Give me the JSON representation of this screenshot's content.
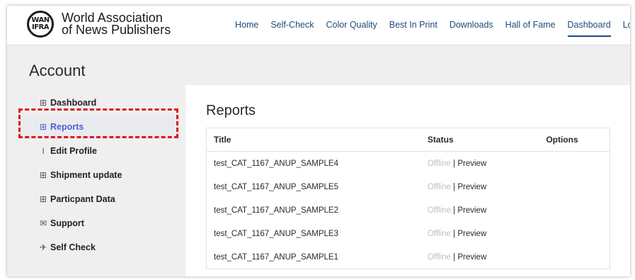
{
  "header": {
    "logo_mark_top": "WAN",
    "logo_mark_bottom": "IFRA",
    "org_line1": "World Association",
    "org_line2": "of News Publishers",
    "nav": [
      "Home",
      "Self-Check",
      "Color Quality",
      "Best In Print",
      "Downloads",
      "Hall of Fame",
      "Dashboard",
      "Logout"
    ],
    "active_nav": "Dashboard"
  },
  "account_title": "Account",
  "sidebar": {
    "items": [
      {
        "label": "Dashboard",
        "icon": "grid-icon",
        "glyph": "⊞"
      },
      {
        "label": "Reports",
        "icon": "grid-icon",
        "glyph": "⊞"
      },
      {
        "label": "Edit Profile",
        "icon": "text-cursor-icon",
        "glyph": "I"
      },
      {
        "label": "Shipment update",
        "icon": "grid-icon",
        "glyph": "⊞"
      },
      {
        "label": "Particpant Data",
        "icon": "grid-icon",
        "glyph": "⊞"
      },
      {
        "label": "Support",
        "icon": "envelope-icon",
        "glyph": "✉"
      },
      {
        "label": "Self Check",
        "icon": "send-icon",
        "glyph": "✈"
      }
    ],
    "active": "Reports"
  },
  "reports": {
    "title": "Reports",
    "columns": [
      "Title",
      "Status",
      "Options"
    ],
    "rows": [
      {
        "title": "test_CAT_1167_ANUP_SAMPLE4",
        "status": "Offline",
        "action": "Preview"
      },
      {
        "title": "test_CAT_1167_ANUP_SAMPLE5",
        "status": "Offline",
        "action": "Preview"
      },
      {
        "title": "test_CAT_1167_ANUP_SAMPLE2",
        "status": "Offline",
        "action": "Preview"
      },
      {
        "title": "test_CAT_1167_ANUP_SAMPLE3",
        "status": "Offline",
        "action": "Preview"
      },
      {
        "title": "test_CAT_1167_ANUP_SAMPLE1",
        "status": "Offline",
        "action": "Preview"
      }
    ],
    "separator": "|"
  },
  "colors": {
    "nav_link": "#1f4a7a",
    "active_sidebar": "#4b5fd6",
    "highlight": "#e0141a",
    "offline": "#bfbfbf"
  }
}
